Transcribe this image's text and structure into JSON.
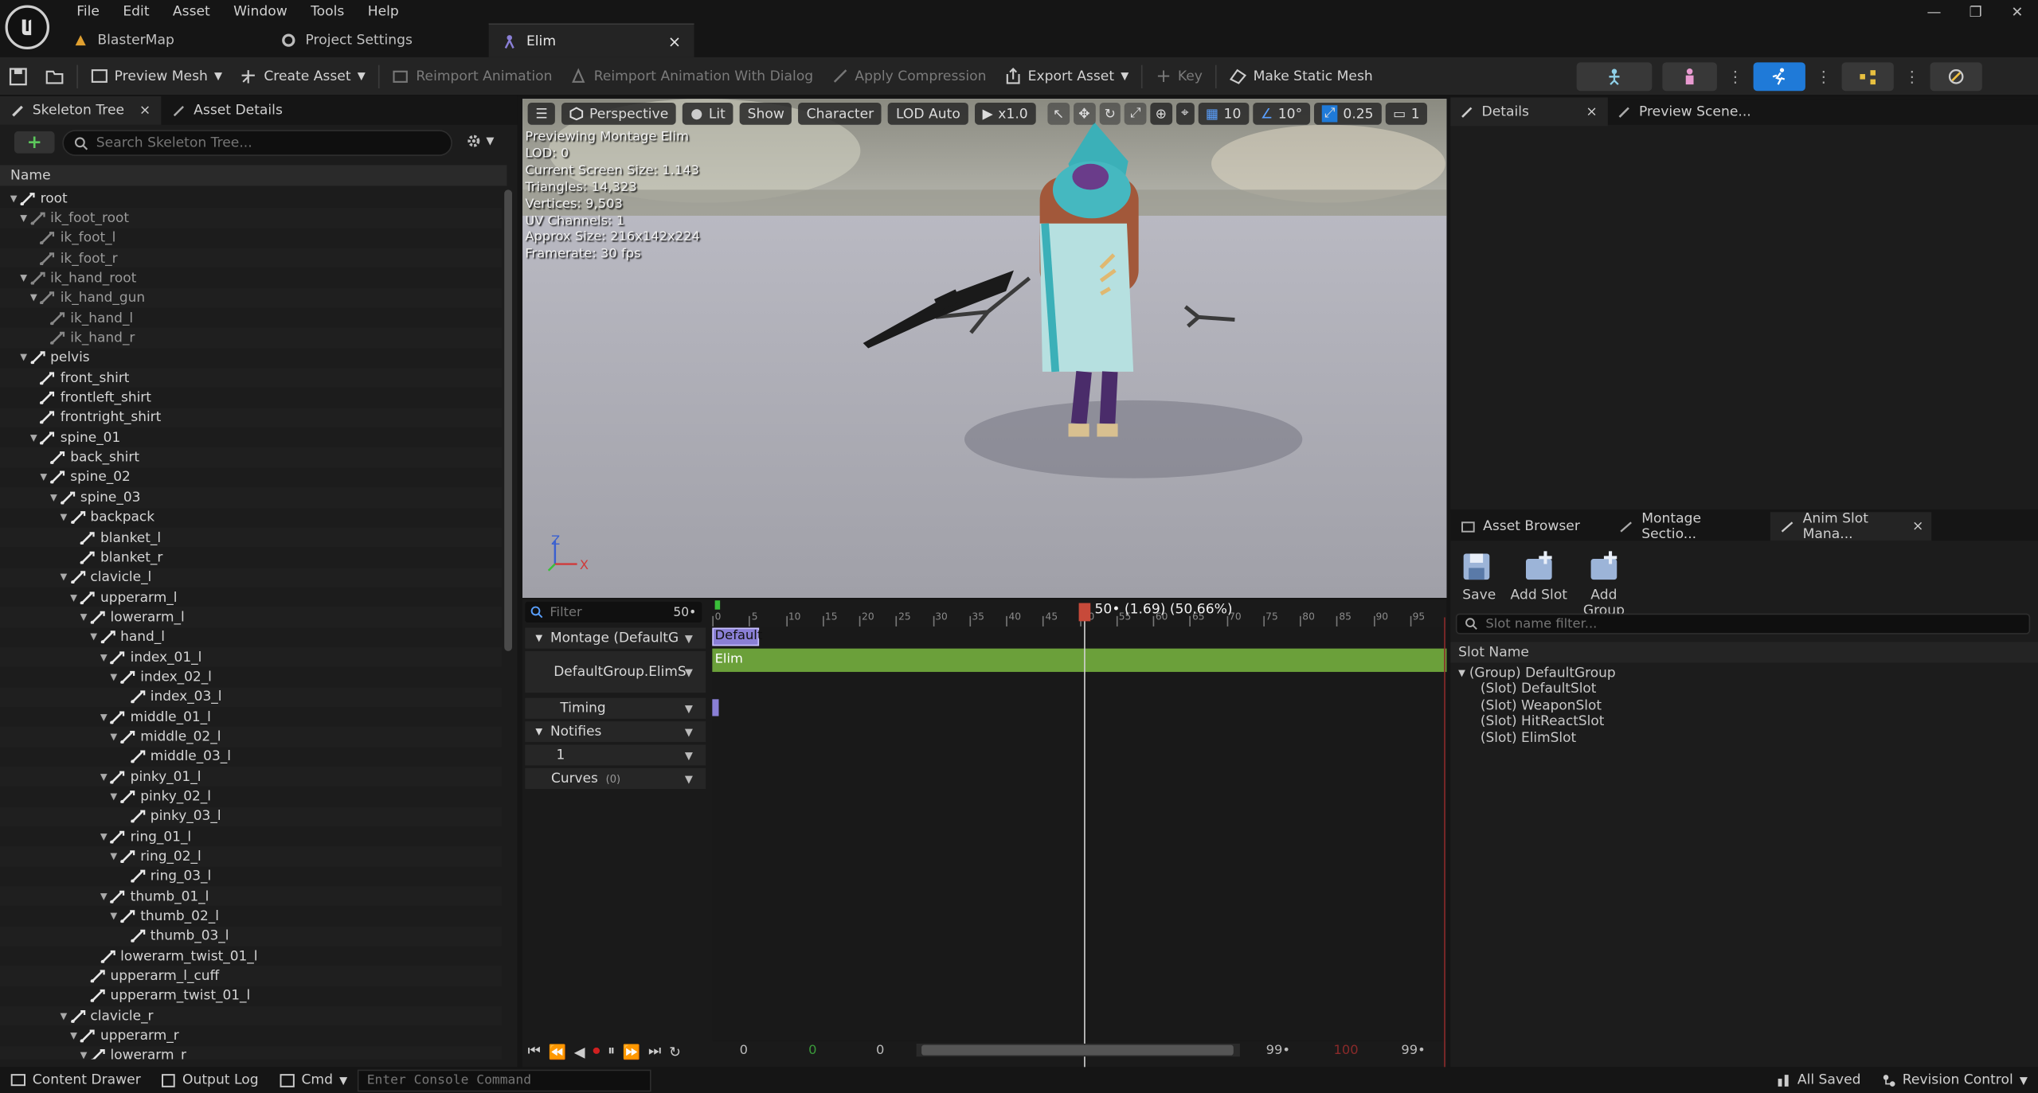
{
  "menu": [
    "File",
    "Edit",
    "Asset",
    "Window",
    "Tools",
    "Help"
  ],
  "doc_tabs": [
    {
      "label": "BlasterMap"
    },
    {
      "label": "Project Settings"
    },
    {
      "label": "Elim",
      "close": "×"
    }
  ],
  "toolbar": {
    "preview_mesh": "Preview Mesh",
    "create_asset": "Create Asset",
    "reimport_animation": "Reimport Animation",
    "reimport_with_dialog": "Reimport Animation With Dialog",
    "apply_compression": "Apply Compression",
    "export_asset": "Export Asset",
    "key": "Key",
    "make_static_mesh": "Make Static Mesh"
  },
  "left_panel": {
    "tab_skeleton": "Skeleton Tree",
    "tab_close": "×",
    "tab_details": "Asset Details",
    "search_placeholder": "Search Skeleton Tree...",
    "column_name": "Name",
    "bones": [
      {
        "n": "root",
        "d": 0,
        "e": "open"
      },
      {
        "n": "ik_foot_root",
        "d": 1,
        "e": "open",
        "v": true
      },
      {
        "n": "ik_foot_l",
        "d": 2,
        "v": true
      },
      {
        "n": "ik_foot_r",
        "d": 2,
        "v": true
      },
      {
        "n": "ik_hand_root",
        "d": 1,
        "e": "open",
        "v": true
      },
      {
        "n": "ik_hand_gun",
        "d": 2,
        "e": "open",
        "v": true
      },
      {
        "n": "ik_hand_l",
        "d": 3,
        "v": true
      },
      {
        "n": "ik_hand_r",
        "d": 3,
        "v": true
      },
      {
        "n": "pelvis",
        "d": 1,
        "e": "open"
      },
      {
        "n": "front_shirt",
        "d": 2
      },
      {
        "n": "frontleft_shirt",
        "d": 2
      },
      {
        "n": "frontright_shirt",
        "d": 2
      },
      {
        "n": "spine_01",
        "d": 2,
        "e": "open"
      },
      {
        "n": "back_shirt",
        "d": 3
      },
      {
        "n": "spine_02",
        "d": 3,
        "e": "open"
      },
      {
        "n": "spine_03",
        "d": 4,
        "e": "open"
      },
      {
        "n": "backpack",
        "d": 5,
        "e": "open"
      },
      {
        "n": "blanket_l",
        "d": 6
      },
      {
        "n": "blanket_r",
        "d": 6
      },
      {
        "n": "clavicle_l",
        "d": 5,
        "e": "open"
      },
      {
        "n": "upperarm_l",
        "d": 6,
        "e": "open"
      },
      {
        "n": "lowerarm_l",
        "d": 7,
        "e": "open"
      },
      {
        "n": "hand_l",
        "d": 8,
        "e": "open"
      },
      {
        "n": "index_01_l",
        "d": 9,
        "e": "open"
      },
      {
        "n": "index_02_l",
        "d": 10,
        "e": "open"
      },
      {
        "n": "index_03_l",
        "d": 11
      },
      {
        "n": "middle_01_l",
        "d": 9,
        "e": "open"
      },
      {
        "n": "middle_02_l",
        "d": 10,
        "e": "open"
      },
      {
        "n": "middle_03_l",
        "d": 11
      },
      {
        "n": "pinky_01_l",
        "d": 9,
        "e": "open"
      },
      {
        "n": "pinky_02_l",
        "d": 10,
        "e": "open"
      },
      {
        "n": "pinky_03_l",
        "d": 11
      },
      {
        "n": "ring_01_l",
        "d": 9,
        "e": "open"
      },
      {
        "n": "ring_02_l",
        "d": 10,
        "e": "open"
      },
      {
        "n": "ring_03_l",
        "d": 11
      },
      {
        "n": "thumb_01_l",
        "d": 9,
        "e": "open"
      },
      {
        "n": "thumb_02_l",
        "d": 10,
        "e": "open"
      },
      {
        "n": "thumb_03_l",
        "d": 11
      },
      {
        "n": "lowerarm_twist_01_l",
        "d": 8
      },
      {
        "n": "upperarm_l_cuff",
        "d": 7
      },
      {
        "n": "upperarm_twist_01_l",
        "d": 7
      },
      {
        "n": "clavicle_r",
        "d": 5,
        "e": "open"
      },
      {
        "n": "upperarm_r",
        "d": 6,
        "e": "open"
      },
      {
        "n": "lowerarm_r",
        "d": 7,
        "e": "open"
      }
    ]
  },
  "viewport": {
    "perspective": "Perspective",
    "lit": "Lit",
    "show": "Show",
    "character": "Character",
    "lod": "LOD Auto",
    "speed": "x1.0",
    "grid": "10",
    "angle": "10°",
    "scale": "0.25",
    "camera": "1",
    "stats": [
      "Previewing Montage Elim",
      "LOD: 0",
      "Current Screen Size: 1.143",
      "Triangles: 14,323",
      "Vertices: 9,503",
      "UV Channels: 1",
      "Approx Size: 216x142x224",
      "Framerate: 30 fps"
    ],
    "axis_z": "Z",
    "axis_x": "X"
  },
  "timeline": {
    "filter_placeholder": "Filter",
    "frame_readout": "50•",
    "playhead_label": "50• (1.69) (50.66%)",
    "ruler_ticks": [
      "0",
      "5",
      "10",
      "15",
      "20",
      "25",
      "30",
      "35",
      "40",
      "45",
      "50",
      "55",
      "60",
      "65",
      "70",
      "75",
      "80",
      "85",
      "90",
      "95"
    ],
    "montage_track": "Montage (DefaultG",
    "slot_track": "DefaultGroup.ElimS",
    "timing": "Timing",
    "notifies": "Notifies",
    "notify_row": "1",
    "curves": "Curves",
    "curves_count": "(0)",
    "section_label": "Default",
    "segment_label": "Elim",
    "playhead_percent": 50.66,
    "bottom": {
      "start": "0",
      "start_green": "0",
      "current": "0",
      "end1": "99•",
      "end_red": "100",
      "end2": "99•"
    }
  },
  "details": {
    "tab_details": "Details",
    "tab_close": "×",
    "tab_preview": "Preview Scene..."
  },
  "slot_manager": {
    "tab_asset_browser": "Asset Browser",
    "tab_montage": "Montage Sectio...",
    "tab_anim_slot": "Anim Slot Mana...",
    "tab_close": "×",
    "save": "Save",
    "add_slot": "Add Slot",
    "add_group": "Add Group",
    "filter_placeholder": "Slot name filter...",
    "column": "Slot Name",
    "group": "(Group) DefaultGroup",
    "slots": [
      "(Slot) DefaultSlot",
      "(Slot) WeaponSlot",
      "(Slot) HitReactSlot",
      "(Slot) ElimSlot"
    ]
  },
  "statusbar": {
    "content_drawer": "Content Drawer",
    "output_log": "Output Log",
    "cmd": "Cmd",
    "console_placeholder": "Enter Console Command",
    "all_saved": "All Saved",
    "revision_control": "Revision Control"
  },
  "colors": {
    "accent_blue": "#2a5db0",
    "track_green": "#6ba03a",
    "section_purple": "#8a7fd6",
    "playhead": "#c74a3a"
  }
}
